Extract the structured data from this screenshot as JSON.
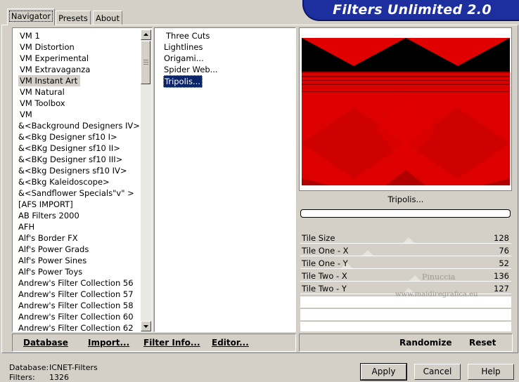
{
  "tabs": [
    {
      "label": "Navigator",
      "active": true
    },
    {
      "label": "Presets",
      "active": false
    },
    {
      "label": "About",
      "active": false
    }
  ],
  "banner_title": "Filters Unlimited 2.0",
  "categories": [
    "VM 1",
    "VM Distortion",
    "VM Experimental",
    "VM Extravaganza",
    "VM Instant Art",
    "VM Natural",
    "VM Toolbox",
    "VM",
    "&<Background Designers IV>",
    "&<Bkg Designer sf10 I>",
    "&<BKg Designer sf10 II>",
    "&<BKg Designer sf10 III>",
    "&<Bkg Designers sf10 IV>",
    "&<Bkg Kaleidoscope>",
    "&<Sandflower Specials\"v\" >",
    "[AFS IMPORT]",
    "AB Filters 2000",
    "AFH",
    "Alf's Border FX",
    "Alf's Power Grads",
    "Alf's Power Sines",
    "Alf's Power Toys",
    "Andrew's Filter Collection 56",
    "Andrew's Filter Collection 57",
    "Andrew's Filter Collection 58",
    "Andrew's Filter Collection 60",
    "Andrew's Filter Collection 62"
  ],
  "selected_category": "VM Instant Art",
  "filters": [
    "Three Cuts",
    "Lightlines",
    "Origami...",
    "Spider Web...",
    "Tripolis..."
  ],
  "selected_filter": "Tripolis...",
  "filter_name": "Tripolis...",
  "params": [
    {
      "label": "Tile Size",
      "value": "128",
      "slider": 0.5
    },
    {
      "label": "Tile One - X",
      "value": "76",
      "slider": 0.3
    },
    {
      "label": "Tile One - Y",
      "value": "52",
      "slider": 0.2
    },
    {
      "label": "Tile Two - X",
      "value": "136",
      "slider": 0.53
    },
    {
      "label": "Tile Two - Y",
      "value": "127",
      "slider": 0.5
    }
  ],
  "watermark": {
    "line1": "Pinuccia",
    "line2": "www.maidiregrafica.eu"
  },
  "left_buttons": [
    "Database",
    "Import...",
    "Filter Info...",
    "Editor..."
  ],
  "right_buttons": [
    "Randomize",
    "Reset"
  ],
  "status": {
    "database_label": "Database:",
    "database_value": "ICNET-Filters",
    "filters_label": "Filters:",
    "filters_value": "1326"
  },
  "dialog_buttons": {
    "apply": "Apply",
    "cancel": "Cancel",
    "help": "Help"
  },
  "colors": {
    "preview_red": "#e00000",
    "banner": "#1d2f9e",
    "selection": "#0a246a"
  }
}
